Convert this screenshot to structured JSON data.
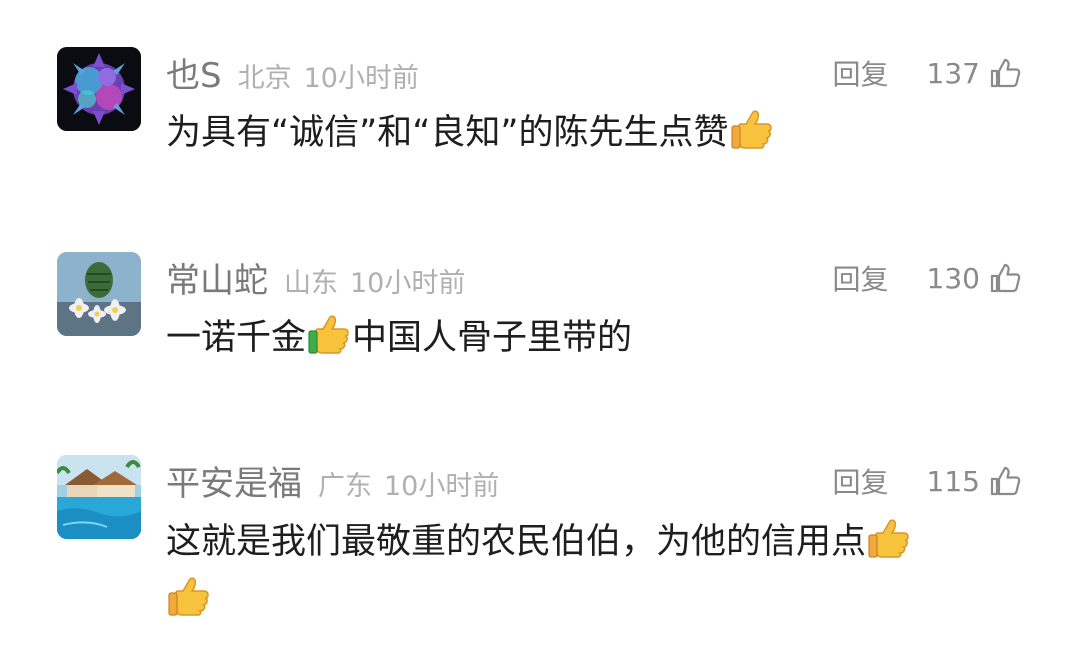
{
  "comments": [
    {
      "user": "也S",
      "location": "北京",
      "time": "10小时前",
      "reply_label": "回复",
      "likes": "137",
      "text_parts": [
        "为具有“诚信”和“良知”的陈先生点赞",
        ""
      ],
      "emoji": "thumbs-up"
    },
    {
      "user": "常山蛇",
      "location": "山东",
      "time": "10小时前",
      "reply_label": "回复",
      "likes": "130",
      "text_parts": [
        "一诺千金",
        "中国人骨子里带的"
      ],
      "emoji": "thumbs-up"
    },
    {
      "user": "平安是福",
      "location": "广东",
      "time": "10小时前",
      "reply_label": "回复",
      "likes": "115",
      "text_parts": [
        "这就是我们最敬重的农民伯伯，为他的信用点",
        ""
      ],
      "emoji": "thumbs-up"
    }
  ],
  "colors": {
    "name": "#7a7a7a",
    "meta": "#b0b0b0",
    "action": "#8a8a8a",
    "body": "#1e1e1e",
    "emoji": "#f7c23c"
  }
}
